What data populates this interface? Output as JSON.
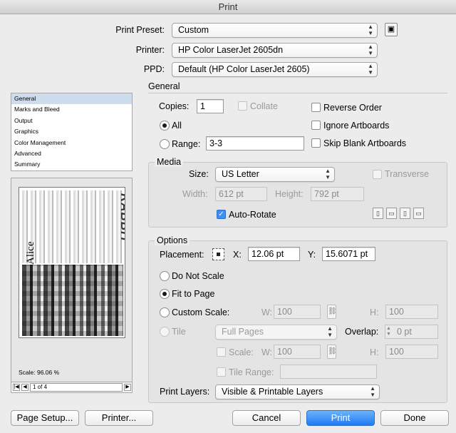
{
  "window": {
    "title": "Print"
  },
  "top": {
    "preset_label": "Print Preset:",
    "preset_value": "Custom",
    "printer_label": "Printer:",
    "printer_value": "HP Color LaserJet 2605dn",
    "ppd_label": "PPD:",
    "ppd_value": "Default (HP Color LaserJet 2605)"
  },
  "sidebar": {
    "items": [
      "General",
      "Marks and Bleed",
      "Output",
      "Graphics",
      "Color Management",
      "Advanced",
      "Summary"
    ],
    "selected": "General"
  },
  "preview": {
    "scale_text": "Scale: 96.06 %",
    "page_indicator": "1 of 4",
    "art_text": {
      "big": "Alice",
      "side": "RABBIT"
    }
  },
  "general": {
    "heading": "General",
    "copies_label": "Copies:",
    "copies_value": "1",
    "collate_label": "Collate",
    "reverse_label": "Reverse Order",
    "all_label": "All",
    "ignore_label": "Ignore Artboards",
    "range_label": "Range:",
    "range_value": "3-3",
    "skip_label": "Skip Blank Artboards"
  },
  "media": {
    "heading": "Media",
    "size_label": "Size:",
    "size_value": "US Letter",
    "transverse_label": "Transverse",
    "width_label": "Width:",
    "width_value": "612 pt",
    "height_label": "Height:",
    "height_value": "792 pt",
    "autorotate_label": "Auto-Rotate",
    "orientation_icons": [
      "portrait-icon",
      "landscape-icon",
      "portrait-flipped-icon",
      "landscape-flipped-icon"
    ]
  },
  "options": {
    "heading": "Options",
    "placement_label": "Placement:",
    "x_label": "X:",
    "x_value": "12.06 pt",
    "y_label": "Y:",
    "y_value": "15.6071 pt",
    "donotscale_label": "Do Not Scale",
    "fit_label": "Fit to Page",
    "custom_label": "Custom Scale:",
    "w_label": "W:",
    "w_value": "100",
    "h_label": "H:",
    "h_value": "100",
    "tile_label": "Tile",
    "tile_value": "Full Pages",
    "overlap_label": "Overlap:",
    "overlap_value": "0 pt",
    "scale_label": "Scale:",
    "scale_w_label": "W:",
    "scale_w_value": "100",
    "scale_h_label": "H:",
    "scale_h_value": "100",
    "tilerange_label": "Tile Range:",
    "layers_label": "Print Layers:",
    "layers_value": "Visible & Printable Layers"
  },
  "footer": {
    "page_setup": "Page Setup...",
    "printer": "Printer...",
    "cancel": "Cancel",
    "print": "Print",
    "done": "Done"
  },
  "colors": {
    "accent": "#1f7af2",
    "selection": "#cfdcee"
  }
}
